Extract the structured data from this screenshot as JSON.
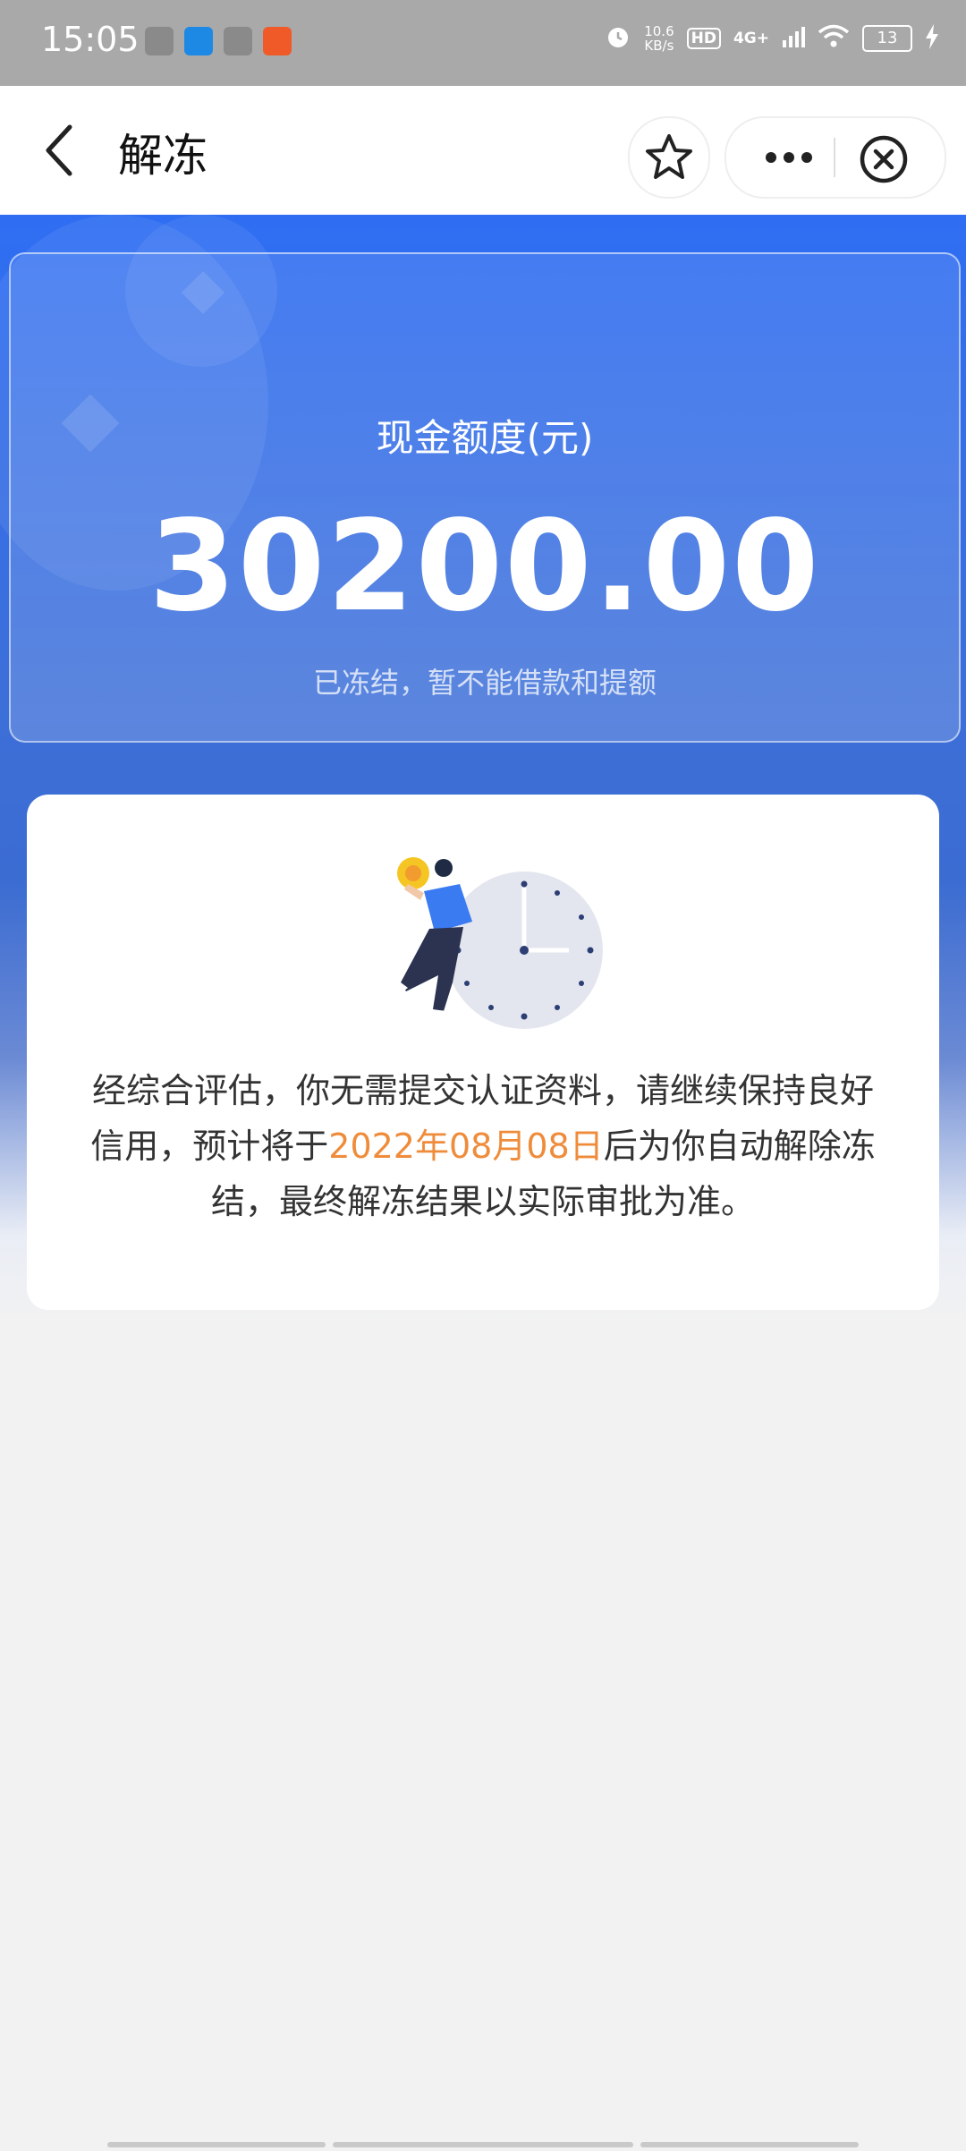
{
  "status_bar": {
    "time": "15:05",
    "speed_value": "10.6",
    "speed_unit": "KB/s",
    "hd": "HD",
    "network": "4G+",
    "battery": "13",
    "app_icons": [
      "scan-app-icon",
      "map-app-icon",
      "video-app-icon",
      "shop-app-icon"
    ],
    "app_icon_colors": [
      "#7a7a7a",
      "#1e88e5",
      "#7a7a7a",
      "#f05a28"
    ]
  },
  "nav": {
    "title": "解冻",
    "icons": [
      "back-icon",
      "star-icon",
      "more-icon",
      "close-icon"
    ]
  },
  "hero": {
    "label": "现金额度(元)",
    "amount": "30200.00",
    "subtitle": "已冻结，暂不能借款和提额"
  },
  "info": {
    "text_before": "经综合评估，你无需提交认证资料，请继续保持良好信用，预计将于",
    "date": "2022年08月08日",
    "text_after": "后为你自动解除冻结，最终解冻结果以实际审批为准。"
  },
  "colors": {
    "primary_blue": "#2f6ef3",
    "highlight_orange": "#ef8c3b",
    "status_bar_gray": "#a9a9a9"
  }
}
